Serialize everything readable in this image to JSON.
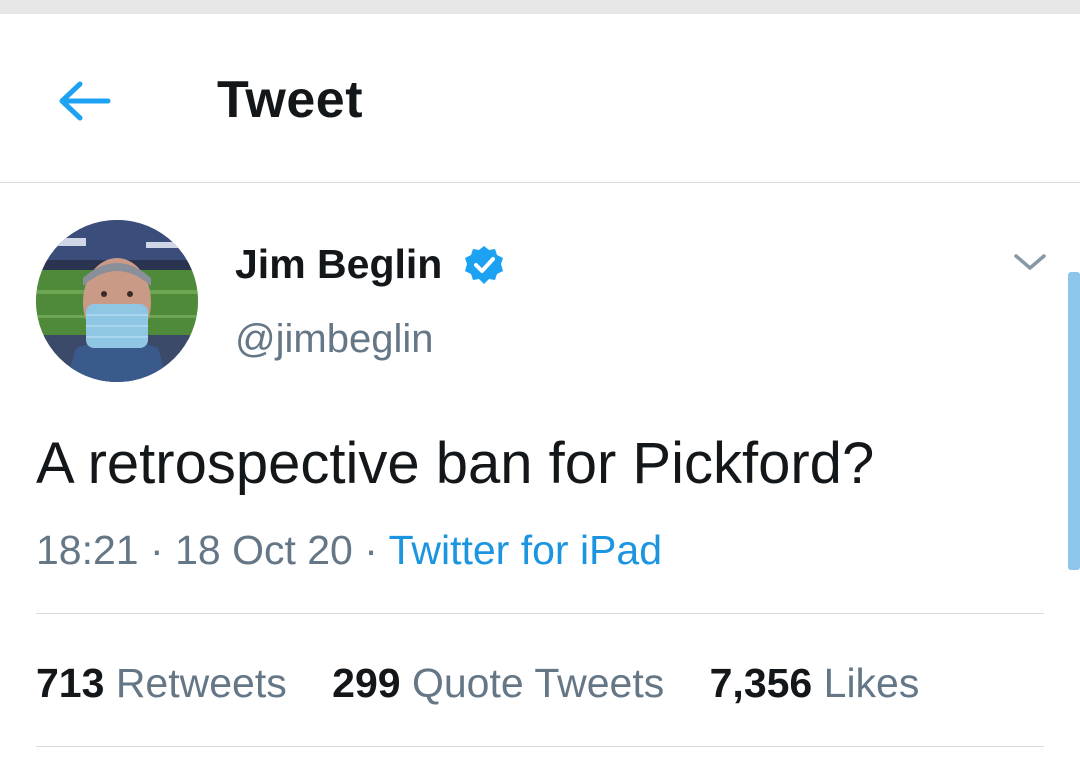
{
  "header": {
    "title": "Tweet",
    "back_icon": "arrow-left-icon",
    "accent_color": "#1da1f2"
  },
  "tweet": {
    "author": {
      "display_name": "Jim Beglin",
      "handle": "@jimbeglin",
      "verified": true,
      "verified_icon": "verified-badge-icon"
    },
    "text": "A retrospective ban for Pickford?",
    "time": "18:21",
    "date": "18 Oct 20",
    "separator": "·",
    "source": "Twitter for iPad",
    "menu_icon": "chevron-down-icon"
  },
  "stats": {
    "retweets": {
      "count": "713",
      "label": "Retweets"
    },
    "quote_tweets": {
      "count": "299",
      "label": "Quote Tweets"
    },
    "likes": {
      "count": "7,356",
      "label": "Likes"
    }
  },
  "colors": {
    "text_primary": "#14171a",
    "text_secondary": "#657786",
    "link": "#1b95e0",
    "divider": "#d5dde3"
  }
}
